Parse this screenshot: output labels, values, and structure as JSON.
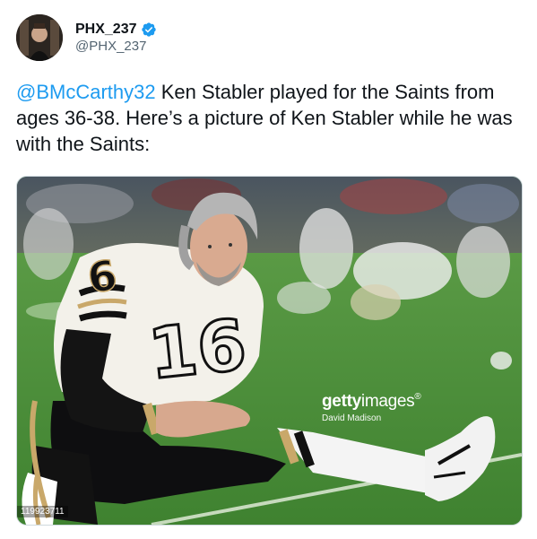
{
  "author": {
    "display_name": "PHX_237",
    "handle": "@PHX_237",
    "verified": true
  },
  "tweet": {
    "mention": "@BMcCarthy32",
    "text": " Ken Stabler played for the Saints from ages 36-38. Here’s a picture of Ken Stabler while he was with the Saints:"
  },
  "media": {
    "watermark_brand_bold": "getty",
    "watermark_brand_light": "images",
    "watermark_registered": "®",
    "watermark_credit": "David Madison",
    "image_id": "119923711"
  },
  "colors": {
    "link": "#1d9bf0",
    "verified_badge": "#1d9bf0",
    "text_primary": "#0f1419",
    "text_secondary": "#536471"
  },
  "icons": {
    "verified": "verified-badge-icon"
  }
}
